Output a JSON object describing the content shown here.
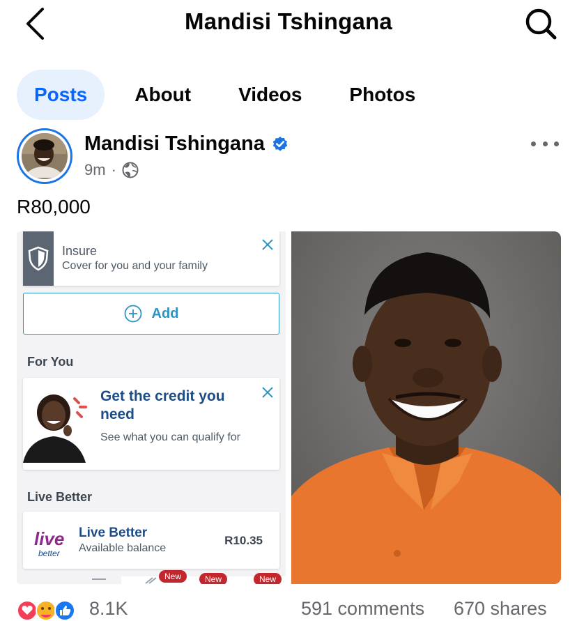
{
  "header": {
    "title": "Mandisi Tshingana",
    "back_icon": "chevron-left-icon",
    "search_icon": "search-icon"
  },
  "tabs": [
    {
      "label": "Posts",
      "active": true
    },
    {
      "label": "About",
      "active": false
    },
    {
      "label": "Videos",
      "active": false
    },
    {
      "label": "Photos",
      "active": false
    }
  ],
  "post": {
    "author": "Mandisi Tshingana",
    "verified": true,
    "time": "9m",
    "separator": "·",
    "audience_icon": "globe-icon",
    "text": "R80,000",
    "left_image": {
      "insure_title": "Insure",
      "insure_subtitle": "Cover for you and your family",
      "add_label": "Add",
      "for_you_heading": "For You",
      "credit_title": "Get the credit you need",
      "credit_subtitle": "See what you can qualify for",
      "live_better_heading": "Live Better",
      "live_better_logo_top": "live",
      "live_better_logo_bottom": "better",
      "live_better_title": "Live Better",
      "live_better_subtitle": "Available balance",
      "live_better_amount": "R10.35",
      "new_badges": [
        "New",
        "New",
        "New"
      ]
    },
    "reactions_count": "8.1K",
    "comments": "591 comments",
    "shares": "670 shares"
  },
  "colors": {
    "accent": "#0866ff",
    "verified": "#1b74e4",
    "muted": "#65676b",
    "app_blue": "#1e4c86",
    "app_button": "#2c93c5"
  }
}
